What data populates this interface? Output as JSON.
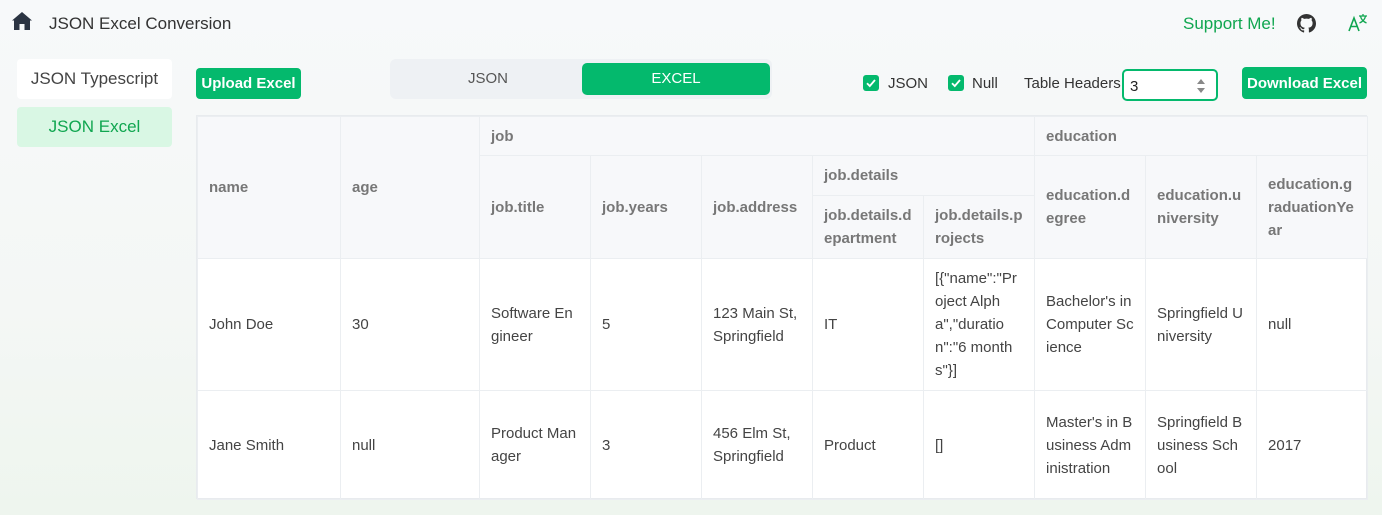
{
  "header": {
    "title": "JSON Excel Conversion",
    "support_label": "Support Me!"
  },
  "sidebar": {
    "items": [
      {
        "label": "JSON Typescript",
        "active": false
      },
      {
        "label": "JSON Excel",
        "active": true
      }
    ]
  },
  "toolbar": {
    "upload_label": "Upload Excel",
    "segment": {
      "json_label": "JSON",
      "excel_label": "EXCEL",
      "selected": "EXCEL"
    },
    "checks": {
      "json_label": "JSON",
      "json_checked": true,
      "null_label": "Null",
      "null_checked": true
    },
    "headers_label": "Table Headers",
    "headers_value": "3",
    "download_label": "Download Excel"
  },
  "table": {
    "header_groups": {
      "name": "name",
      "age": "age",
      "job": "job",
      "job_title": "job.title",
      "job_years": "job.years",
      "job_address": "job.address",
      "job_details": "job.details",
      "job_details_department": "job.details.department",
      "job_details_projects": "job.details.projects",
      "education": "education",
      "education_degree": "education.degree",
      "education_university": "education.university",
      "education_graduation": "education.graduationYear"
    },
    "rows": [
      [
        "John Doe",
        "30",
        "Software Engineer",
        "5",
        "123 Main St, Springfield",
        "IT",
        "[{\"name\":\"Project Alpha\",\"duration\":\"6 months\"}]",
        "Bachelor's in Computer Science",
        "Springfield University",
        "null"
      ],
      [
        "Jane Smith",
        "null",
        "Product Manager",
        "3",
        "456 Elm St, Springfield",
        "Product",
        "[]",
        "Master's in Business Administration",
        "Springfield Business School",
        "2017"
      ]
    ]
  },
  "colors": {
    "accent": "#04b96d",
    "accent_text": "#10a650",
    "active_bg": "#d9f7e4"
  },
  "icons": {
    "home": "home-icon",
    "github": "github-icon",
    "translate": "translate-icon"
  }
}
